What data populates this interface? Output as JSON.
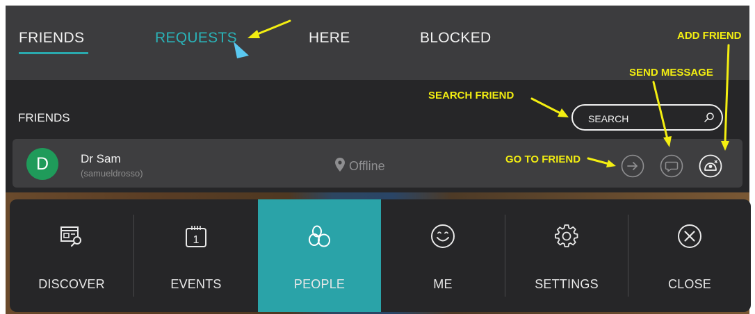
{
  "tabs": [
    {
      "label": "FRIENDS",
      "active": true
    },
    {
      "label": "REQUESTS",
      "active": false
    },
    {
      "label": "HERE",
      "active": false
    },
    {
      "label": "BLOCKED",
      "active": false
    }
  ],
  "section_title": "FRIENDS",
  "search": {
    "placeholder": "SEARCH"
  },
  "friend": {
    "initial": "D",
    "name": "Dr Sam",
    "handle": "(samueldrosso)",
    "status": "Offline"
  },
  "menu": [
    {
      "label": "DISCOVER",
      "icon": "discover-icon",
      "active": false
    },
    {
      "label": "EVENTS",
      "icon": "calendar-icon",
      "active": false
    },
    {
      "label": "PEOPLE",
      "icon": "people-icon",
      "active": true
    },
    {
      "label": "ME",
      "icon": "smiley-icon",
      "active": false
    },
    {
      "label": "SETTINGS",
      "icon": "gear-icon",
      "active": false
    },
    {
      "label": "CLOSE",
      "icon": "close-icon",
      "active": false
    }
  ],
  "annotations": {
    "add_friend": "ADD FRIEND",
    "send_message": "SEND MESSAGE",
    "search_friend": "SEARCH FRIEND",
    "go_to_friend": "GO TO FRIEND"
  },
  "colors": {
    "accent": "#2aa3a8",
    "annotation": "#f3ee11",
    "avatar": "#1f9b5a"
  }
}
